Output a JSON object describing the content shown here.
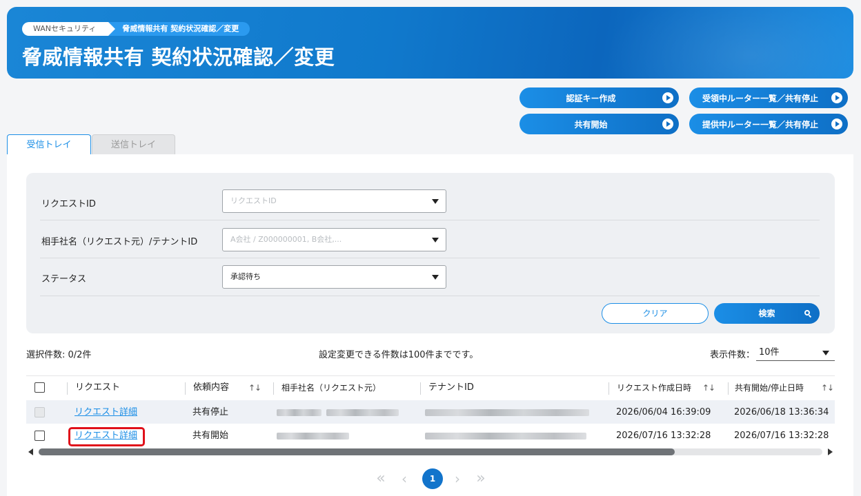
{
  "header": {
    "breadcrumb_home": "WANセキュリティ",
    "breadcrumb_current": "脅威情報共有 契約状況確認／変更",
    "title": "脅威情報共有 契約状況確認／変更"
  },
  "actions": {
    "create_key": "認証キー作成",
    "receiving_routers": "受領中ルーター一覧／共有停止",
    "start_sharing": "共有開始",
    "providing_routers": "提供中ルーター一覧／共有停止"
  },
  "tabs": {
    "inbox": "受信トレイ",
    "outbox": "送信トレイ"
  },
  "filter": {
    "request_id_label": "リクエストID",
    "request_id_placeholder": "リクエストID",
    "partner_label": "相手社名（リクエスト元）/テナントID",
    "partner_placeholder": "A会社 / Z000000001, B会社,...",
    "status_label": "ステータス",
    "status_value": "承認待ち",
    "clear": "クリア",
    "search": "検索"
  },
  "summary": {
    "selected": "選択件数: 0/2件",
    "limit_note": "設定変更できる件数は100件までです。",
    "per_page_label": "表示件数：",
    "per_page_value": "10件"
  },
  "table": {
    "headers": {
      "request": "リクエスト",
      "content": "依頼内容",
      "partner": "相手社名（リクエスト元）",
      "tenant": "テナントID",
      "created": "リクエスト作成日時",
      "share_date": "共有開始/停止日時",
      "sort_symbol": "↑↓"
    },
    "rows": [
      {
        "link": "リクエスト詳細",
        "content": "共有停止",
        "created": "2026/06/04 16:39:09",
        "share_date": "2026/06/18 13:36:34"
      },
      {
        "link": "リクエスト詳細",
        "content": "共有開始",
        "created": "2026/07/16 13:32:28",
        "share_date": "2026/07/16 13:32:28"
      }
    ]
  },
  "pagination": {
    "first": "«",
    "prev": "‹",
    "current": "1",
    "next": "›",
    "last": "»"
  }
}
